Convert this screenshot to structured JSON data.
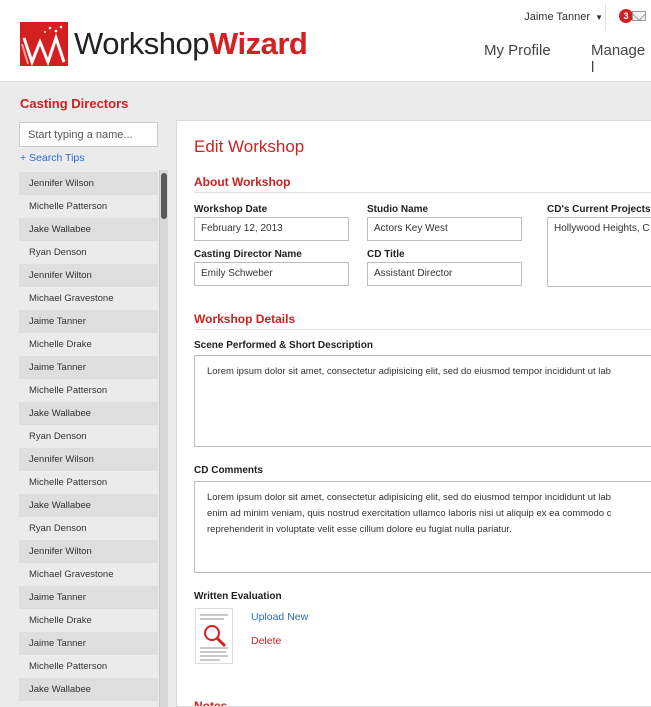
{
  "header": {
    "logo_word1": "Workshop",
    "logo_word2": "Wizard",
    "user_name": "Jaime Tanner",
    "notifications": "3",
    "nav": [
      "My Profile",
      "Manage l"
    ]
  },
  "sidebar": {
    "title": "Casting Directors",
    "search_placeholder": "Start typing a name...",
    "search_tips": "+ Search Tips",
    "directors": [
      "Jennifer Wilson",
      "Michelle Patterson",
      "Jake Wallabee",
      "Ryan Denson",
      "Jennifer Wilton",
      "Michael Gravestone",
      "Jaime Tanner",
      "Michelle Drake",
      "Jaime Tanner",
      "Michelle Patterson",
      "Jake Wallabee",
      "Ryan Denson",
      "Jennifer Wilson",
      "Michelle Patterson",
      "Jake Wallabee",
      "Ryan Denson",
      "Jennifer Wilton",
      "Michael Gravestone",
      "Jaime Tanner",
      "Michelle Drake",
      "Jaime Tanner",
      "Michelle Patterson",
      "Jake Wallabee"
    ]
  },
  "main": {
    "title": "Edit Workshop",
    "about": {
      "heading": "About Workshop",
      "workshop_date_label": "Workshop Date",
      "workshop_date": "February 12, 2013",
      "studio_label": "Studio Name",
      "studio": "Actors Key West",
      "project_label": "CD's Current Projects",
      "project": "Hollywood Heights, C",
      "director_label": "Casting Director Name",
      "director": "Emily Schweber",
      "cd_title_label": "CD Title",
      "cd_title": "Assistant Director"
    },
    "details": {
      "heading": "Workshop Details",
      "scene_label": "Scene Performed & Short Description",
      "scene_text": "Lorem ipsum dolor sit amet, consectetur adipisicing elit, sed do eiusmod tempor incididunt ut lab",
      "comments_label": "CD Comments",
      "comments_text": "Lorem ipsum dolor sit amet, consectetur adipisicing elit, sed do eiusmod tempor incididunt ut lab\nenim ad minim veniam, quis nostrud exercitation ullamco laboris nisi ut aliquip ex ea commodo c\nreprehenderit in voluptate velit esse cillum dolore eu fugiat nulla pariatur.",
      "evaluation_label": "Written Evaluation",
      "upload_label": "Upload New",
      "delete_label": "Delete"
    },
    "notes_heading": "Notes"
  },
  "colors": {
    "brand_red": "#d42020",
    "link_blue": "#2a6bd1"
  }
}
